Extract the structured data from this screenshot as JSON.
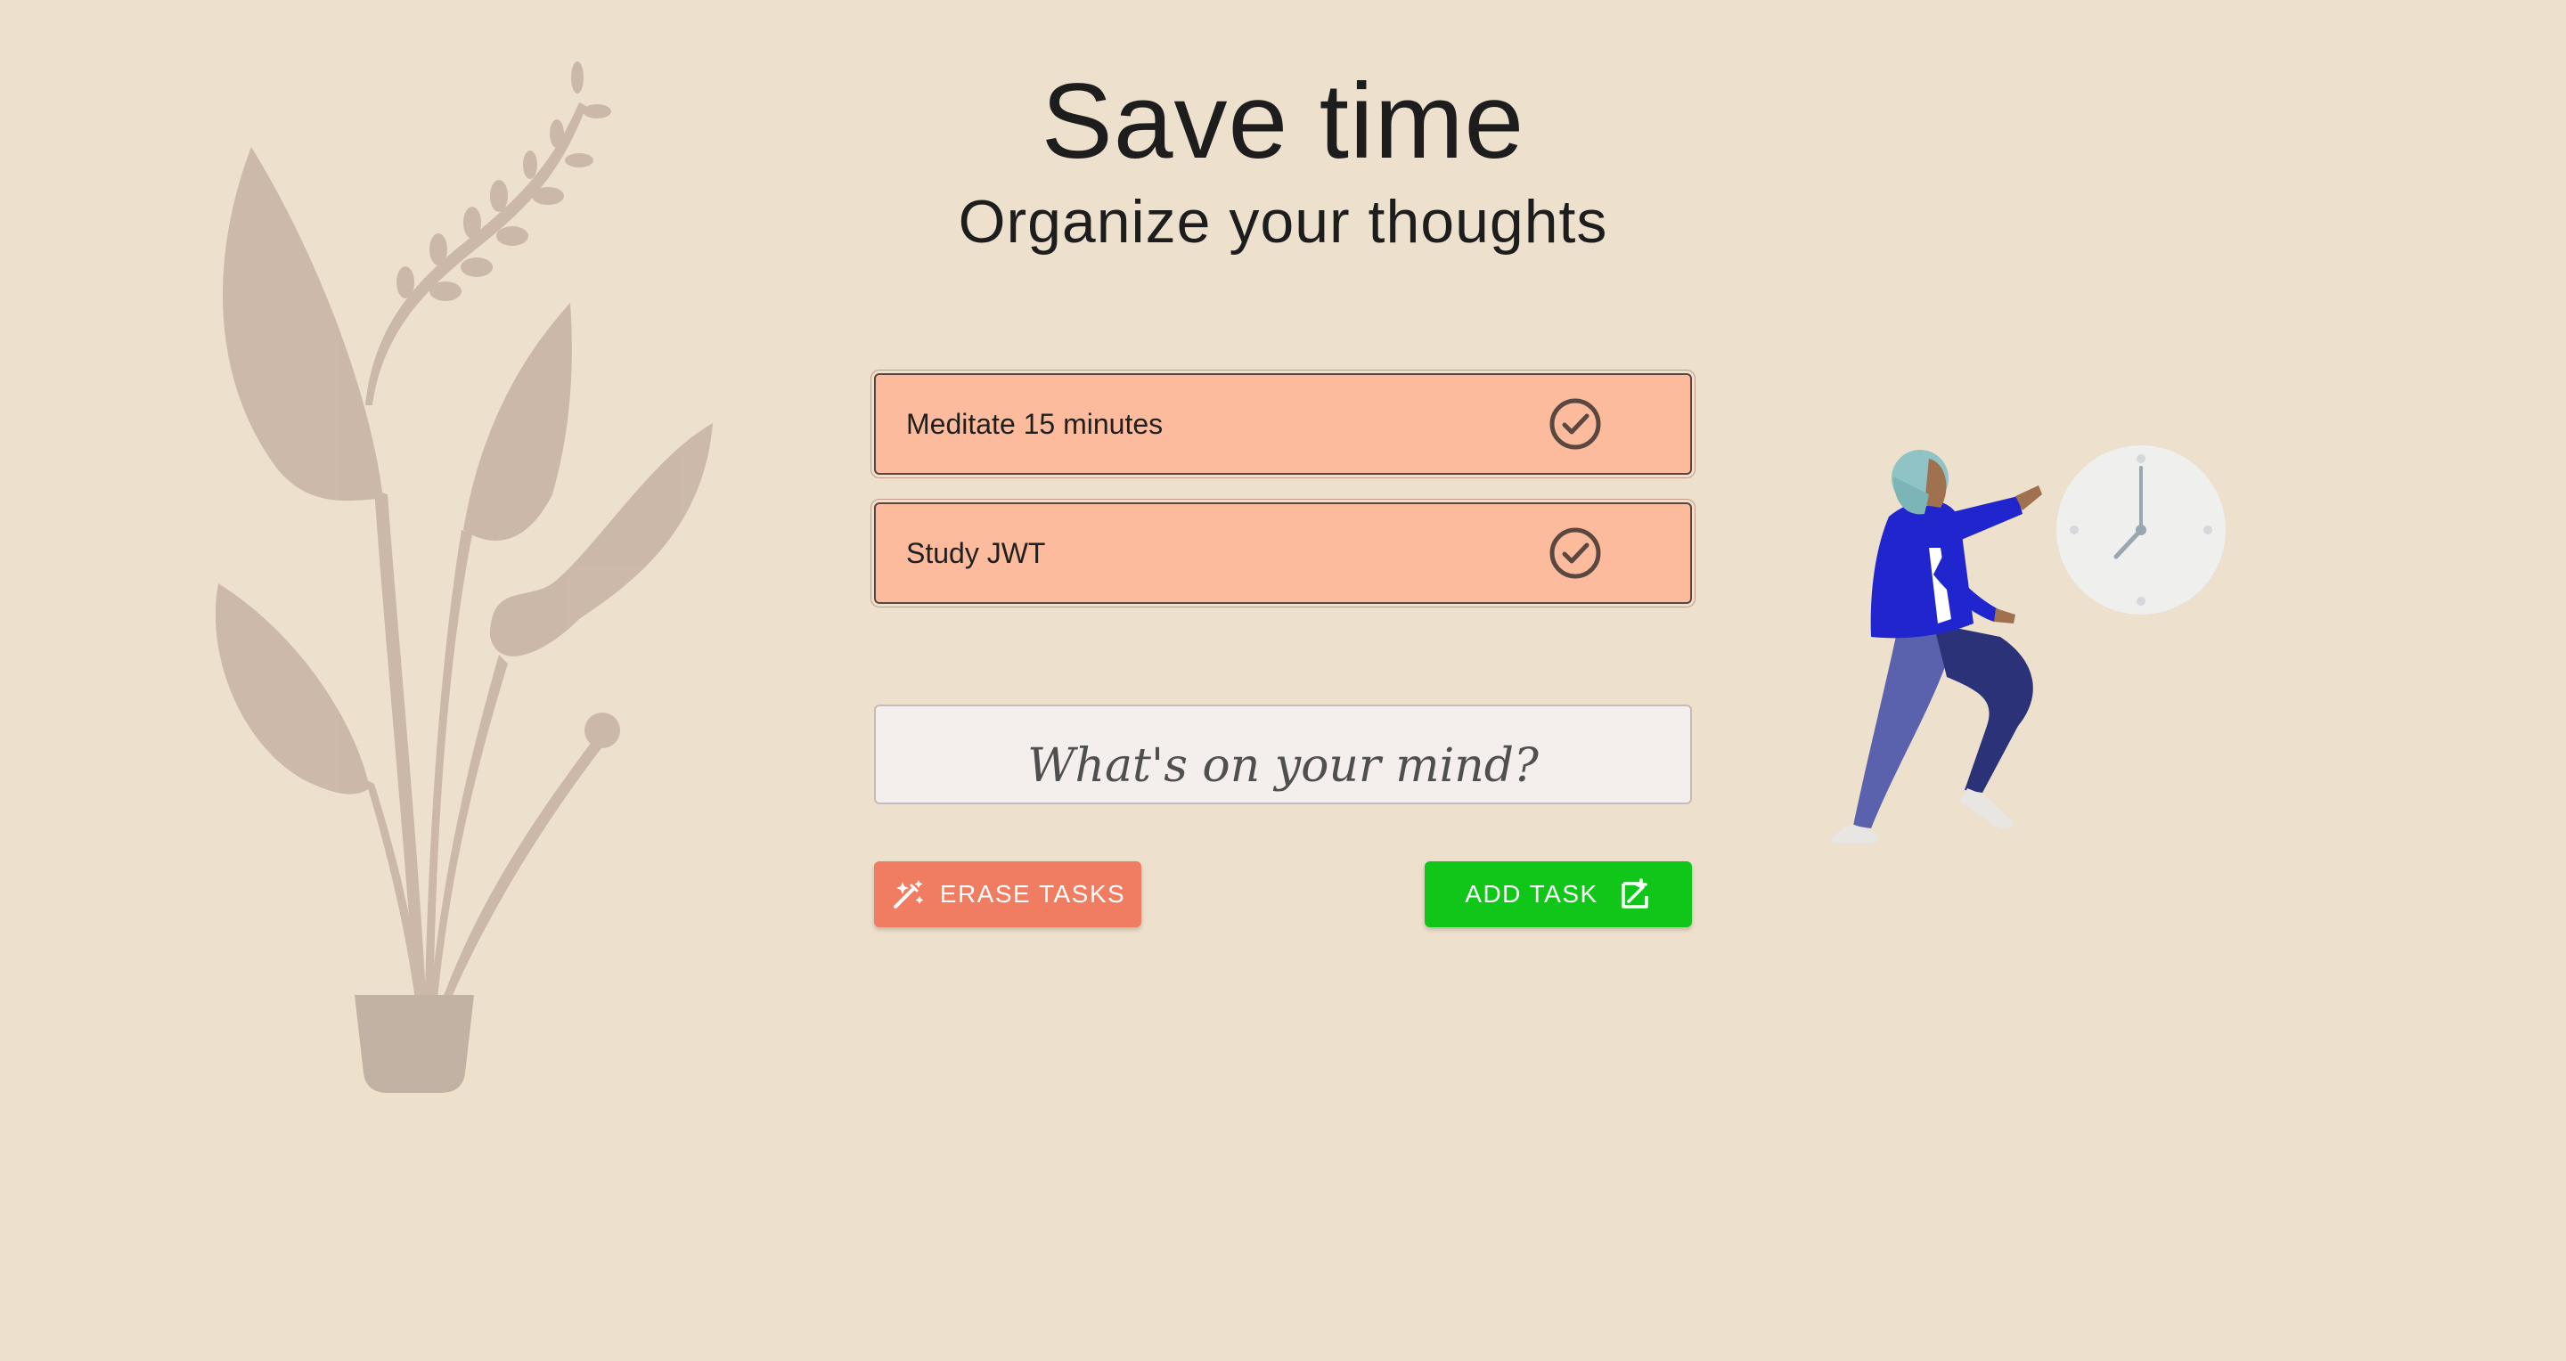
{
  "hero": {
    "title": "Save time",
    "subtitle": "Organize your thoughts"
  },
  "tasks": [
    {
      "text": "Meditate 15 minutes",
      "done_icon": "check-circle-icon"
    },
    {
      "text": "Study JWT",
      "done_icon": "check-circle-icon"
    }
  ],
  "input": {
    "placeholder": "What's on your mind?",
    "value": ""
  },
  "buttons": {
    "erase_label": "ERASE TASKS",
    "erase_icon": "magic-wand-icon",
    "add_label": "ADD TASK",
    "add_icon": "add-note-icon"
  },
  "colors": {
    "background": "#ede0cc",
    "task_bg": "#fdbb9d",
    "erase_button": "#f07c61",
    "add_button": "#10c618",
    "plant": "#cbb6a7",
    "clock_face": "#efefee"
  },
  "illustrations": {
    "left": "potted-plant-illustration",
    "right": "woman-chasing-clock-illustration"
  }
}
